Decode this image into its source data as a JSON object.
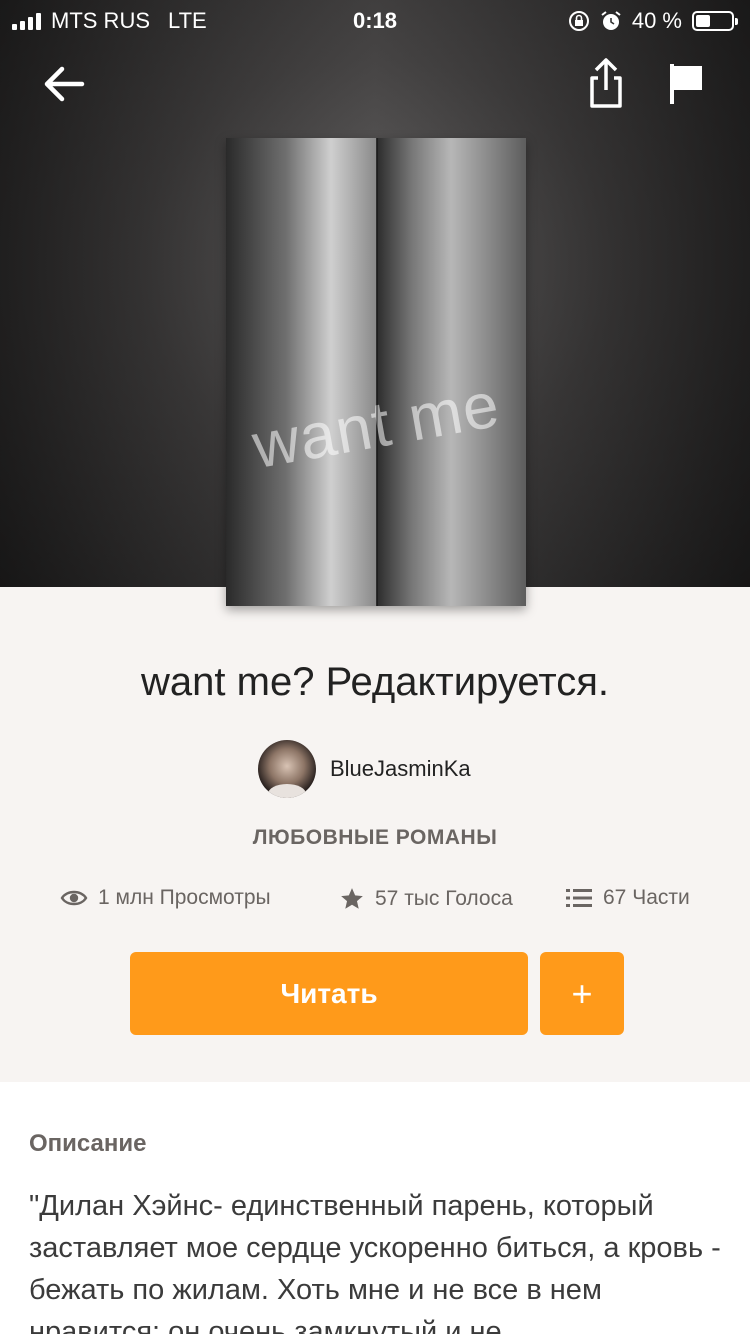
{
  "status_bar": {
    "carrier": "MTS RUS",
    "network": "LTE",
    "time": "0:18",
    "battery": "40 %",
    "battery_level": 0.4
  },
  "nav": {
    "back_icon": "arrow-left-icon",
    "share_icon": "share-icon",
    "report_icon": "flag-icon"
  },
  "story": {
    "cover_text": "want me",
    "title": "want me? Редактируется.",
    "author": "BlueJasminKa",
    "genre": "ЛЮБОВНЫЕ РОМАНЫ"
  },
  "stats": {
    "views": "1 млн Просмотры",
    "votes": "57 тыс Голоса",
    "parts": "67 Части"
  },
  "actions": {
    "read_label": "Читать",
    "add_label": "+"
  },
  "description": {
    "heading": "Описание",
    "text": "\"Дилан Хэйнс- единственный парень, который заставляет мое сердце ускоренно биться, а кровь - бежать по жилам. Хоть мне и не все в нем нравится: он очень замкнутый и не"
  },
  "colors": {
    "accent": "#ff9a1a",
    "muted_text": "#6a6562",
    "page_bg": "#f7f4f2"
  }
}
